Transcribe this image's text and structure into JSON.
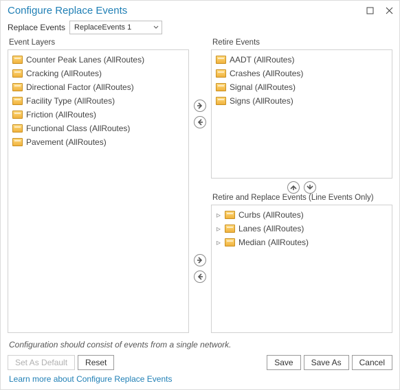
{
  "title": "Configure Replace Events",
  "replace_label": "Replace Events",
  "combo_value": "ReplaceEvents 1",
  "headers": {
    "left": "Event Layers",
    "retire": "Retire Events",
    "retrep": "Retire and Replace Events (Line Events Only)"
  },
  "event_layers": [
    "Counter Peak Lanes (AllRoutes)",
    "Cracking (AllRoutes)",
    "Directional Factor (AllRoutes)",
    "Facility Type (AllRoutes)",
    "Friction (AllRoutes)",
    "Functional Class (AllRoutes)",
    "Pavement (AllRoutes)"
  ],
  "retire_events": [
    "AADT (AllRoutes)",
    "Crashes (AllRoutes)",
    "Signal (AllRoutes)",
    "Signs (AllRoutes)"
  ],
  "retrep_events": [
    "Curbs (AllRoutes)",
    "Lanes (AllRoutes)",
    "Median (AllRoutes)"
  ],
  "hint": "Configuration should consist of events from a single network.",
  "buttons": {
    "set_default": "Set As Default",
    "reset": "Reset",
    "save": "Save",
    "save_as": "Save As",
    "cancel": "Cancel"
  },
  "link": "Learn more about Configure Replace Events"
}
